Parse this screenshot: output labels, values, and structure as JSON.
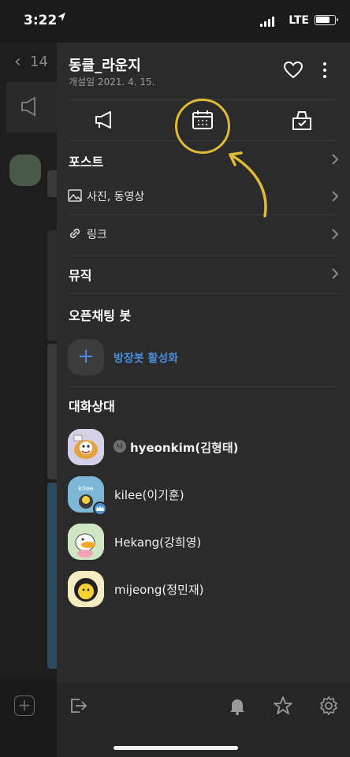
{
  "status_bar": {
    "time": "3:22",
    "network": "LTE"
  },
  "background_chat": {
    "back_count": "14"
  },
  "drawer": {
    "title": "동클_라운지",
    "created_date": "개설일 2021. 4. 15.",
    "tabs": [
      {
        "icon": "megaphone-icon"
      },
      {
        "icon": "calendar-icon"
      },
      {
        "icon": "vote-box-icon"
      }
    ],
    "annotation_color": "#e0b936",
    "sections": {
      "post": "포스트",
      "photos_videos": "사진, 동영상",
      "links": "링크",
      "music": "뮤직",
      "open_chat_bot": "오픈채팅 봇",
      "bot_activate": "방장봇 활성화",
      "participants": "대화상대"
    },
    "me_badge": "나",
    "members": [
      {
        "name": "hyeonkim(김형태)",
        "is_me": true
      },
      {
        "name": "kilee(이기훈)",
        "avatar_text": "kilee",
        "is_host": true
      },
      {
        "name": "Hekang(강희영)"
      },
      {
        "name": "mijeong(정민재)"
      }
    ],
    "bottom_icons": [
      "exit-icon",
      "bell-icon",
      "star-icon",
      "settings-icon"
    ]
  },
  "colors": {
    "accent_blue": "#4a8ad8",
    "panel_bg": "#2b2b2b",
    "highlight": "#e0b936"
  }
}
